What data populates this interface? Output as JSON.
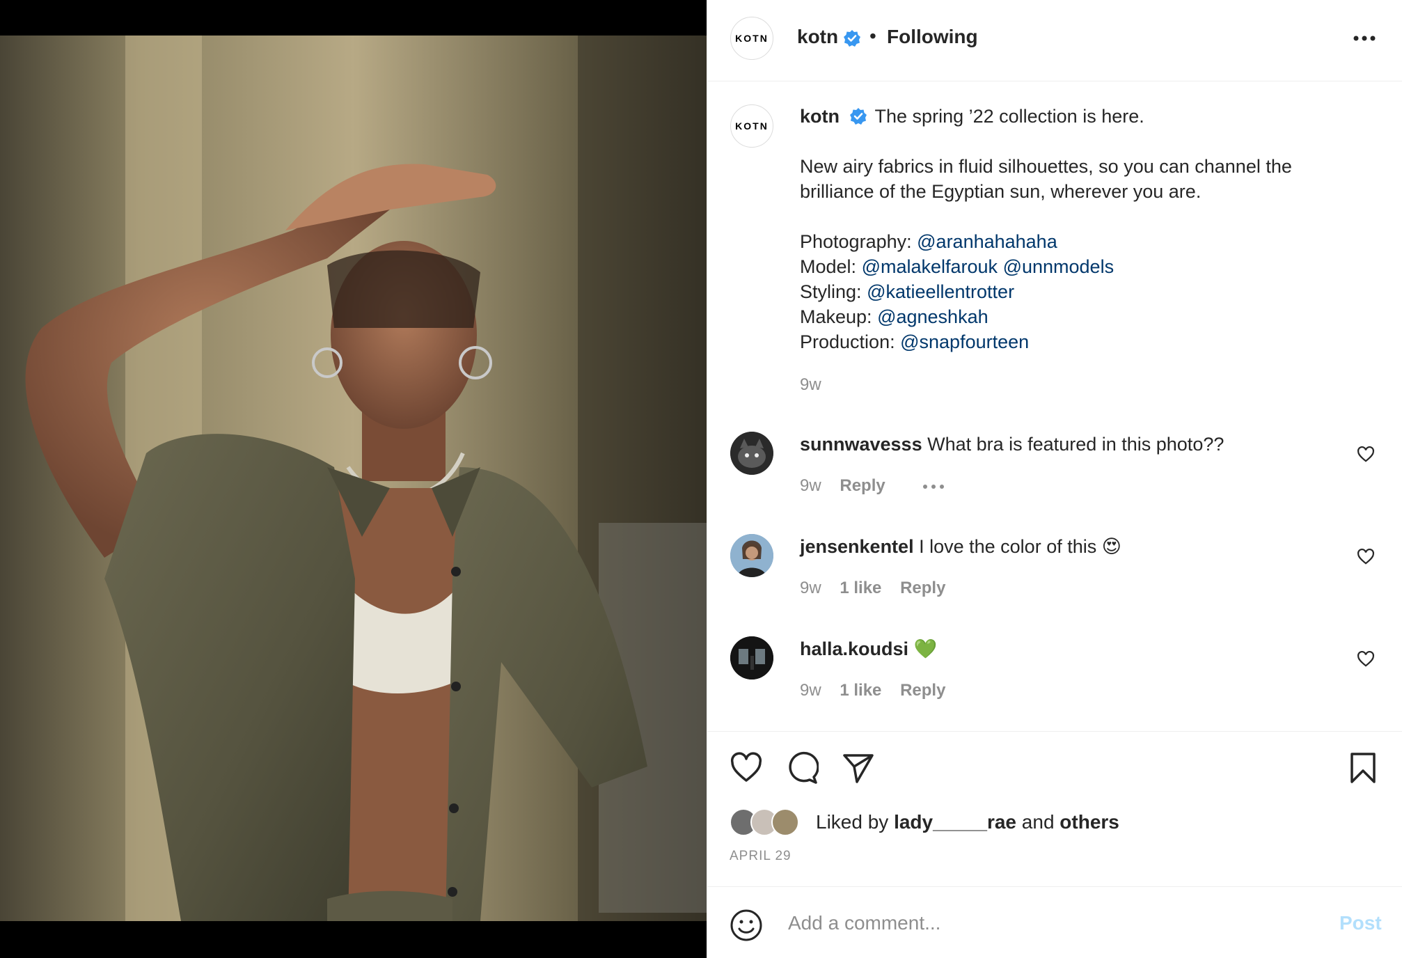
{
  "post": {
    "brand_logo_text": "KOTN",
    "username": "kotn",
    "separator": "•",
    "follow_status": "Following"
  },
  "caption": {
    "username": "kotn",
    "first_line": "The spring ’22 collection is here.",
    "paragraph": "New airy fabrics in fluid silhouettes, so you can channel the brilliance of the Egyptian sun, wherever you are.",
    "credits": [
      {
        "label": "Photography:",
        "mentions": [
          "@aranhahahaha"
        ]
      },
      {
        "label": "Model:",
        "mentions": [
          "@malakelfarouk",
          "@unnmodels"
        ]
      },
      {
        "label": "Styling:",
        "mentions": [
          "@katieellentrotter"
        ]
      },
      {
        "label": "Makeup:",
        "mentions": [
          "@agneshkah"
        ]
      },
      {
        "label": "Production:",
        "mentions": [
          "@snapfourteen"
        ]
      }
    ],
    "time": "9w"
  },
  "comments": [
    {
      "username": "sunnwavesss",
      "text": "What bra is featured in this photo??",
      "time": "9w",
      "likes": "",
      "reply": "Reply",
      "avatar_color": "#3a3a3a"
    },
    {
      "username": "jensenkentel",
      "text": "I love the color of this 😍",
      "time": "9w",
      "likes": "1 like",
      "reply": "Reply",
      "avatar_color": "#7fa3c4"
    },
    {
      "username": "halla.koudsi",
      "text": "💚",
      "time": "9w",
      "likes": "1 like",
      "reply": "Reply",
      "avatar_color": "#1c1c1c"
    }
  ],
  "actions": {
    "liked_prefix": "Liked by",
    "liked_user": "lady_____rae",
    "liked_and": "and",
    "liked_others": "others",
    "date": "APRIL 29"
  },
  "add_comment": {
    "placeholder": "Add a comment...",
    "post_label": "Post"
  },
  "colors": {
    "verified": "#3897f0",
    "link": "#00376b",
    "muted": "#8e8e8e",
    "post_disabled": "#b2dffc"
  }
}
